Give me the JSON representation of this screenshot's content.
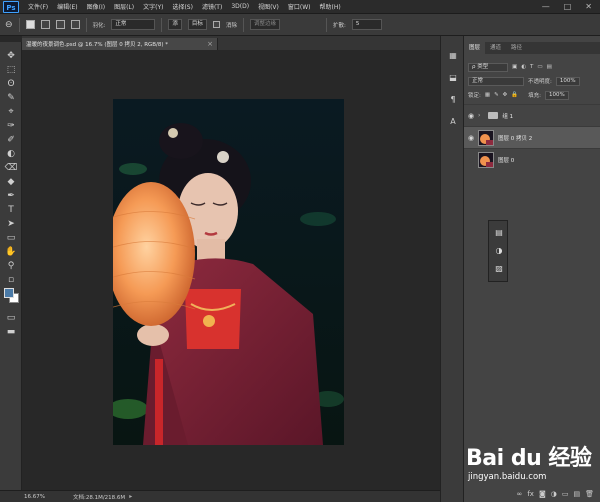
{
  "app": {
    "logo": "Ps",
    "menu": [
      "文件(F)",
      "编辑(E)",
      "图像(I)",
      "图层(L)",
      "文字(Y)",
      "选择(S)",
      "滤镜(T)",
      "3D(D)",
      "视图(V)",
      "窗口(W)",
      "帮助(H)"
    ],
    "window_buttons": [
      "—",
      "□",
      "✕"
    ]
  },
  "options_bar": {
    "feather_label": "羽化:",
    "mode_value": "正常",
    "btn_add": "添",
    "btn_sub": "目标",
    "antialias_label": "消除",
    "refine_label": "调整边缘",
    "size_label": "扩散:",
    "size_value": "5"
  },
  "document": {
    "tab_title": "温暖的夜景调色.psd @ 16.7% (图层 0 拷贝 2, RGB/8) *",
    "zoom": "16.67%",
    "doc_info": "文档:28.1M/218.6M",
    "status_arrow": "▸"
  },
  "tools": [
    "✥",
    "⬚",
    "ʘ",
    "✎",
    "⌖",
    "✑",
    "✐",
    "◐",
    "⌫",
    "◆",
    "✒",
    "T",
    "➤",
    "▭",
    "✋",
    "⚲",
    "▫"
  ],
  "dock_icons": [
    "▦",
    "⬓",
    "¶",
    "A"
  ],
  "layers_panel": {
    "tabs": [
      "图层",
      "通道",
      "路径"
    ],
    "filter_label": "ρ 类型",
    "blend_mode": "正常",
    "opacity_label": "不透明度:",
    "opacity_value": "100%",
    "lock_label": "锁定:",
    "fill_label": "填充:",
    "fill_value": "100%",
    "layers": [
      {
        "name": "组 1",
        "type": "group",
        "visible": true,
        "selected": false
      },
      {
        "name": "图层 0 拷贝 2",
        "type": "pixel",
        "visible": true,
        "selected": true
      },
      {
        "name": "图层 0",
        "type": "pixel",
        "visible": false,
        "selected": false
      }
    ],
    "bottom_icons": [
      "∞",
      "fx",
      "◙",
      "◑",
      "▭",
      "▤",
      "🗑"
    ]
  },
  "mini_panel_icons": [
    "▤",
    "◑",
    "▨"
  ],
  "watermark": {
    "brand": "Bai du 经验",
    "url": "jingyan.baidu.com"
  },
  "colors": {
    "foreground": "#4a7aa7",
    "background": "#ffffff",
    "accent": "#3fa1ff"
  }
}
